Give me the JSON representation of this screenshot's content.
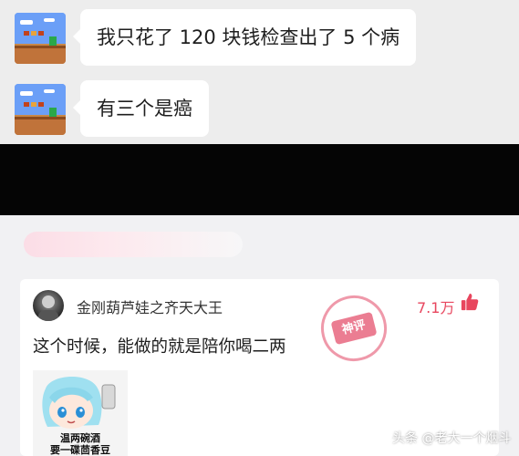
{
  "chat": {
    "messages": [
      {
        "text": "我只花了 120 块钱检查出了 5 个病"
      },
      {
        "text": "有三个是癌"
      }
    ]
  },
  "comment": {
    "username": "金刚葫芦娃之齐天大王",
    "likes": "7.1万",
    "stamp": "神评",
    "text": "这个时候，能做的就是陪你喝二两",
    "meme_caption_line1": "温两碗酒",
    "meme_caption_line2": "要一碟茴香豆"
  },
  "watermark": "头条 @老大一个烟斗",
  "colors": {
    "chat_bg": "#ededed",
    "bubble": "#ffffff",
    "accent": "#e8465e"
  }
}
